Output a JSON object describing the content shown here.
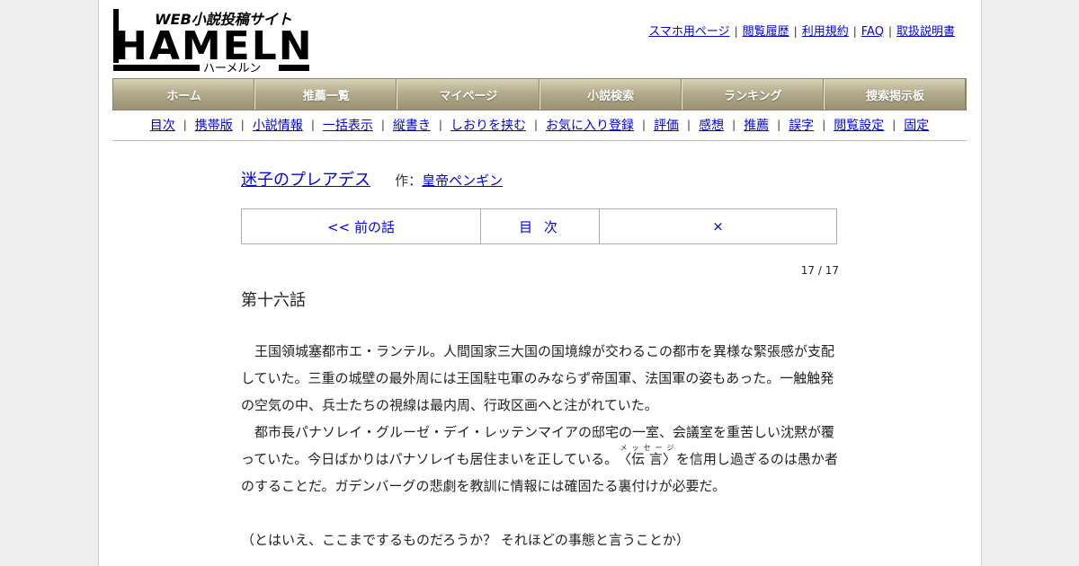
{
  "logo": {
    "tagline": "WEB小説投稿サイト",
    "name": "HAMELN",
    "kana": "ハーメルン"
  },
  "top_links": [
    "スマホ用ページ",
    "閲覧履歴",
    "利用規約",
    "FAQ",
    "取扱説明書"
  ],
  "nav": [
    "ホーム",
    "推薦一覧",
    "マイページ",
    "小説検索",
    "ランキング",
    "捜索掲示板"
  ],
  "subnav": [
    "目次",
    "携帯版",
    "小説情報",
    "一括表示",
    "縦書き",
    "しおりを挟む",
    "お気に入り登録",
    "評価",
    "感想",
    "推薦",
    "誤字",
    "閲覧設定",
    "固定"
  ],
  "novel": {
    "title": "迷子のプレアデス",
    "author_prefix": "作：",
    "author": "皇帝ペンギン"
  },
  "pager": {
    "prev": "<< 前の話",
    "toc": "目 次",
    "next": "×"
  },
  "page_count": "17 / 17",
  "chapter_title": "第十六話",
  "body": {
    "p1": "王国領城塞都市エ・ランテル。人間国家三大国の国境線が交わるこの都市を異様な緊張感が支配していた。三重の城壁の最外周には王国駐屯軍のみならず帝国軍、法国軍の姿もあった。一触触発の空気の中、兵士たちの視線は最内周、行政区画へと注がれていた。",
    "p2_before": "都市長パナソレイ・グルーゼ・デイ・レッテンマイアの邸宅の一室、会議室を重苦しい沈黙が覆っていた。今日ばかりはパナソレイも居住まいを正している。",
    "ruby_base": "〈伝 言〉",
    "ruby_text": "メッセージ",
    "p2_after": "を信用し過ぎるのは愚か者のすることだ。ガデンバーグの悲劇を教訓に情報には確固たる裏付けが必要だ。",
    "p3": "（とはいえ、ここまでするものだろうか？ それほどの事態と言うことか）"
  }
}
